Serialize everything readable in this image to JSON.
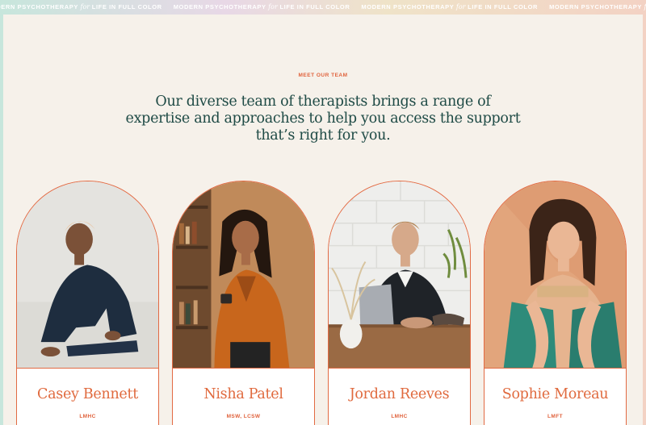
{
  "marquee": {
    "prefix": "MODERN PSYCHOTHERAPY",
    "connector": "for",
    "suffix": "LIFE IN FULL COLOR"
  },
  "section": {
    "eyebrow": "MEET OUR TEAM",
    "headline": "Our diverse team of therapists brings a range of expertise and approaches to help you access the support that’s right for you."
  },
  "team": [
    {
      "name": "Casey Bennett",
      "credentials": "LMHC"
    },
    {
      "name": "Nisha Patel",
      "credentials": "MSW, LCSW"
    },
    {
      "name": "Jordan Reeves",
      "credentials": "LMHC"
    },
    {
      "name": "Sophie Moreau",
      "credentials": "LMFT"
    }
  ],
  "colors": {
    "accent": "#e0623c",
    "headline": "#1e4a45",
    "background": "#f6f1ea"
  }
}
